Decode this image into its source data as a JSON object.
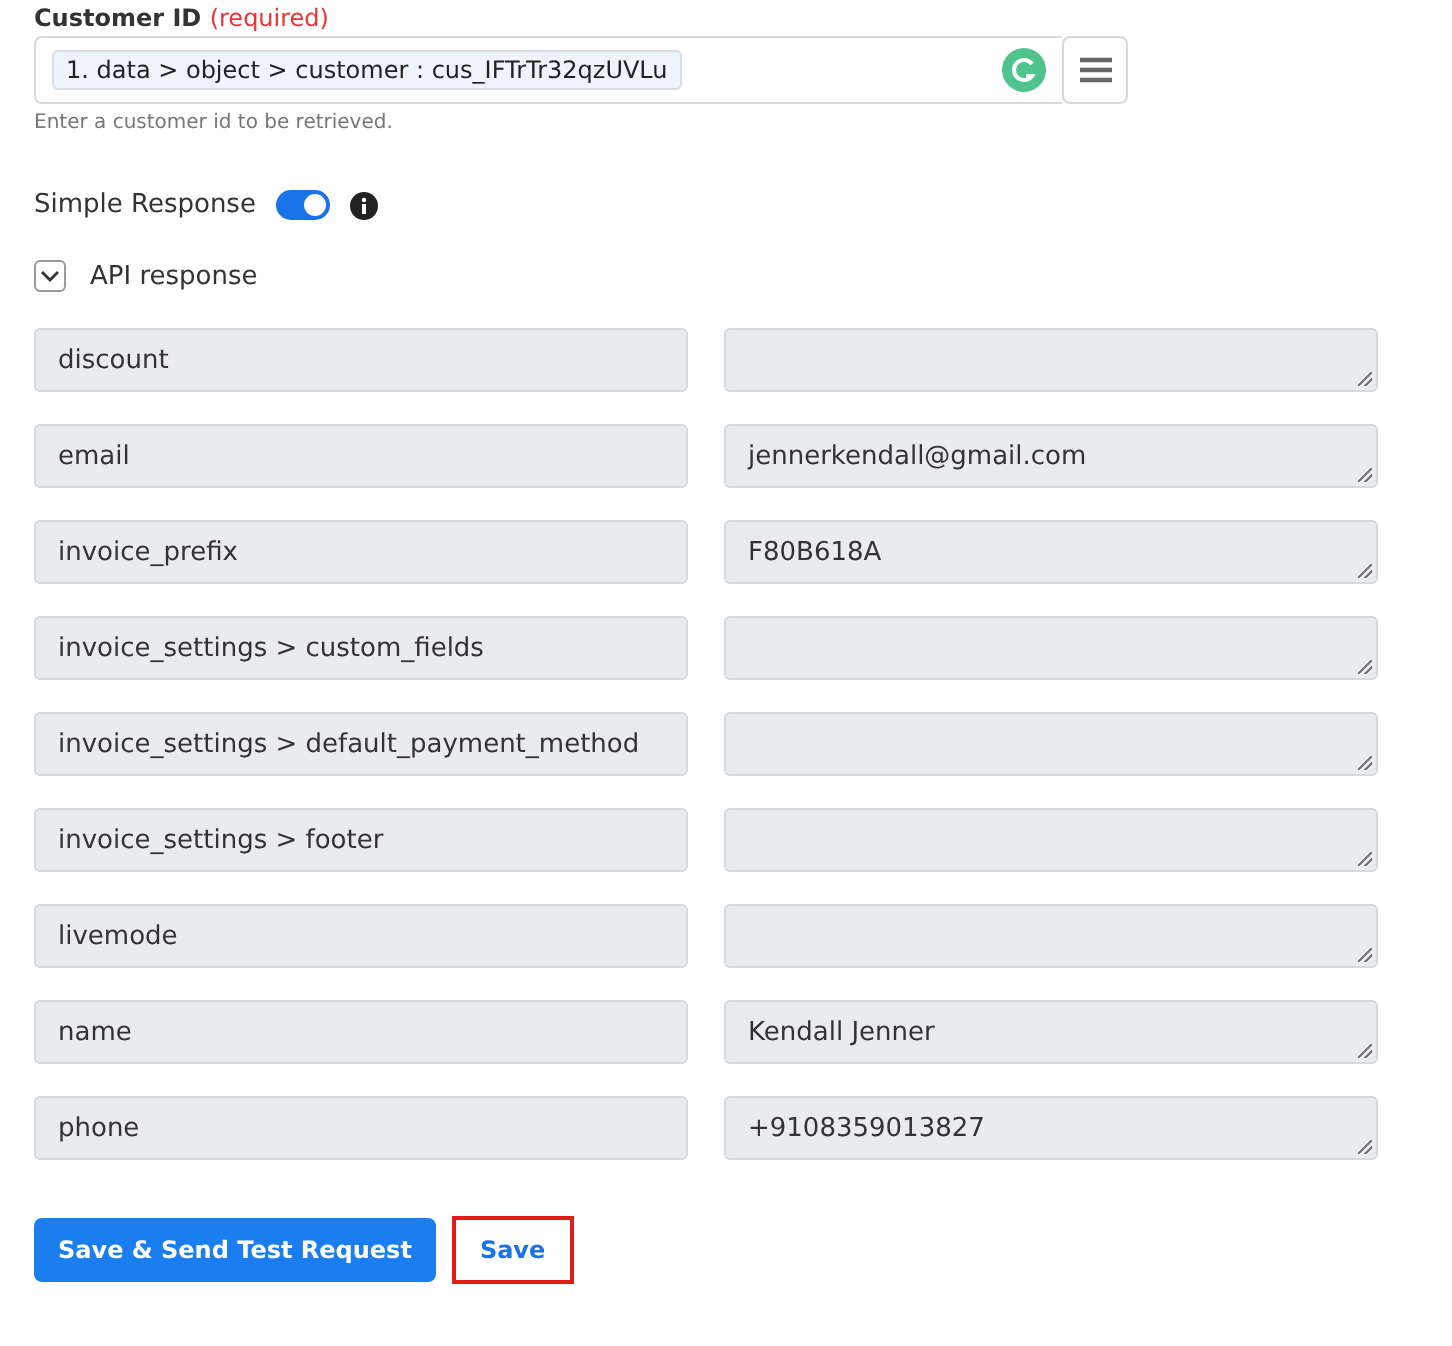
{
  "customer_id": {
    "label": "Customer ID",
    "required": "(required)",
    "value": "1. data > object > customer : cus_IFTrTr32qzUVLu",
    "help": "Enter a customer id to be retrieved."
  },
  "simple_response": {
    "label": "Simple Response",
    "on": true
  },
  "api_response": {
    "label": "API response",
    "expanded": true,
    "rows": [
      {
        "key": "discount",
        "value": ""
      },
      {
        "key": "email",
        "value": "jennerkendall@gmail.com"
      },
      {
        "key": "invoice_prefix",
        "value": "F80B618A"
      },
      {
        "key": "invoice_settings > custom_fields",
        "value": ""
      },
      {
        "key": "invoice_settings > default_payment_method",
        "value": ""
      },
      {
        "key": "invoice_settings > footer",
        "value": ""
      },
      {
        "key": "livemode",
        "value": ""
      },
      {
        "key": "name",
        "value": "Kendall Jenner"
      },
      {
        "key": "phone",
        "value": "+9108359013827"
      }
    ]
  },
  "buttons": [
    {
      "label": "Save & Send Test Request",
      "kind": "primary"
    },
    {
      "label": "Save",
      "kind": "link"
    }
  ]
}
